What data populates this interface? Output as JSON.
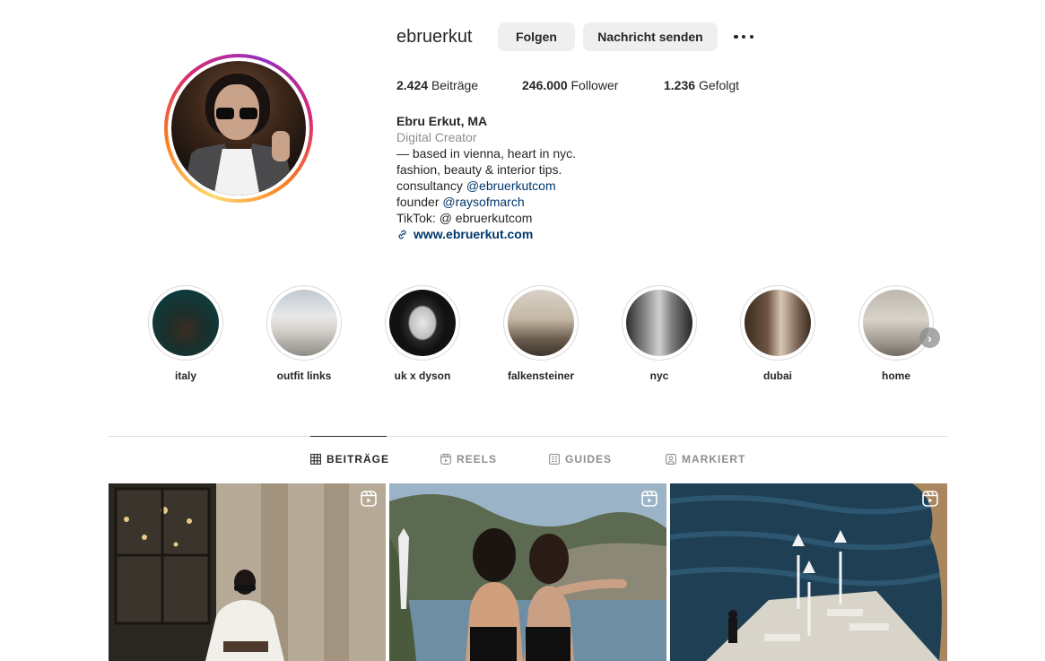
{
  "profile": {
    "username": "ebruerkut",
    "follow_label": "Folgen",
    "message_label": "Nachricht senden",
    "stats": {
      "posts_count": "2.424",
      "posts_label": "Beiträge",
      "followers_count": "246.000",
      "followers_label": "Follower",
      "following_count": "1.236",
      "following_label": "Gefolgt"
    },
    "bio": {
      "name": "Ebru Erkut, MA",
      "category": "Digital Creator",
      "line1": "— based in vienna, heart in nyc.",
      "line2": "fashion, beauty & interior tips.",
      "consultancy_prefix": "consultancy ",
      "consultancy_mention": "@ebruerkutcom",
      "founder_prefix": "founder ",
      "founder_mention": "@raysofmarch",
      "tiktok": "TikTok: @ ebruerkutcom",
      "website": "www.ebruerkut.com"
    }
  },
  "highlights": [
    {
      "label": "italy"
    },
    {
      "label": "outfit links"
    },
    {
      "label": "uk x dyson"
    },
    {
      "label": "falkensteiner"
    },
    {
      "label": "nyc"
    },
    {
      "label": "dubai"
    },
    {
      "label": "home"
    }
  ],
  "tabs": [
    {
      "label": "BEITRÄGE",
      "icon": "grid-icon",
      "active": true
    },
    {
      "label": "REELS",
      "icon": "reels-icon",
      "active": false
    },
    {
      "label": "GUIDES",
      "icon": "guides-icon",
      "active": false
    },
    {
      "label": "MARKIERT",
      "icon": "tagged-icon",
      "active": false
    }
  ],
  "colors": {
    "accent_link": "#00376b",
    "muted_text": "#8e8e8e",
    "button_bg": "#efefef"
  }
}
